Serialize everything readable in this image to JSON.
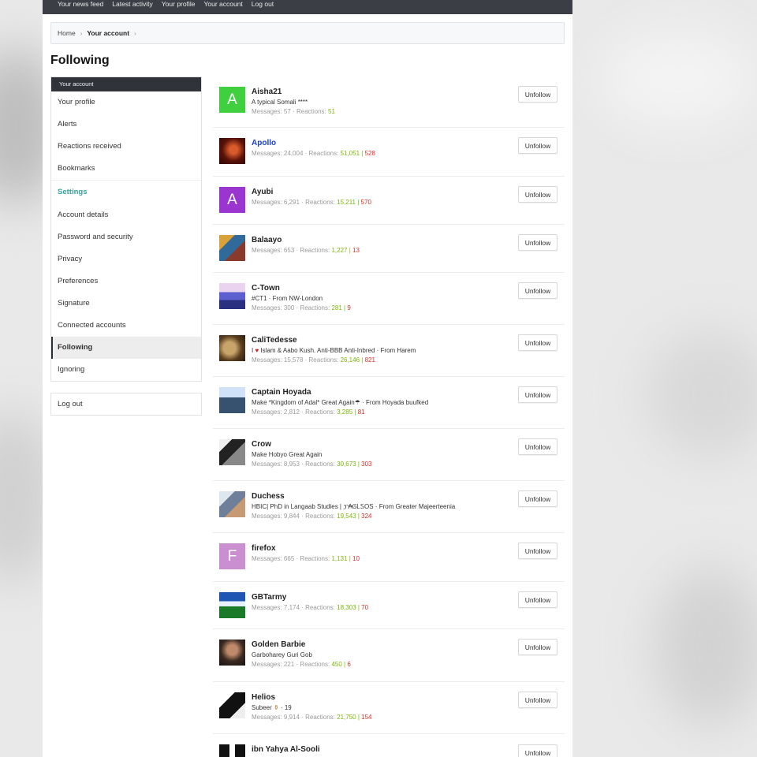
{
  "topnav": [
    "Your news feed",
    "Latest activity",
    "Your profile",
    "Your account",
    "Log out"
  ],
  "breadcrumb": {
    "home": "Home",
    "current": "Your account",
    "sep": "›"
  },
  "page_title": "Following",
  "sidebar": {
    "header": "Your account",
    "group1": [
      "Your profile",
      "Alerts",
      "Reactions received",
      "Bookmarks"
    ],
    "settings_heading": "Settings",
    "group2": [
      "Account details",
      "Password and security",
      "Privacy",
      "Preferences",
      "Signature",
      "Connected accounts",
      "Following",
      "Ignoring"
    ],
    "active": "Following",
    "logout": "Log out"
  },
  "unfollow_label": "Unfollow",
  "stats_labels": {
    "messages": "Messages:",
    "reactions": "Reactions:",
    "dot": "·",
    "bar": "|"
  },
  "colors": {
    "positive": "#7bb60c",
    "negative": "#d9302a",
    "settings_heading": "#3a9ea0",
    "link": "#1b3fd3",
    "topbar": "#3b3f45"
  },
  "following": [
    {
      "name": "Aisha21",
      "title": "A typical Somali ****",
      "messages": "57",
      "reactions": "51",
      "neg": "",
      "avatar_letter": "A",
      "avatar_color": "#3fcf3f"
    },
    {
      "name": "Apollo",
      "title": "",
      "messages": "24,004",
      "reactions": "51,051",
      "neg": "528",
      "avatar_letter": "",
      "avatar_color": "#7a1d10"
    },
    {
      "name": "Ayubi",
      "title": "",
      "messages": "6,291",
      "reactions": "15,211",
      "neg": "570",
      "avatar_letter": "A",
      "avatar_color": "#9b35cf"
    },
    {
      "name": "Balaayo",
      "title": "",
      "messages": "653",
      "reactions": "1,227",
      "neg": "13",
      "avatar_letter": "",
      "avatar_color": "#2f6a9a"
    },
    {
      "name": "C-Town",
      "title": "#CT1 · From NW-London",
      "messages": "300",
      "reactions": "281",
      "neg": "9",
      "avatar_letter": "",
      "avatar_color": "#6b74c9"
    },
    {
      "name": "CaliTedesse",
      "title_pre": "I",
      "title_post": "Islam & Aabo Kush. Anti-BBB Anti-Inbred · From Harem",
      "title": "",
      "messages": "15,578",
      "reactions": "26,146",
      "neg": "821",
      "avatar_letter": "",
      "avatar_color": "#8a6a3a"
    },
    {
      "name": "Captain Hoyada",
      "title": "Make *Kingdom of Adal* Great Again☂ · From Hoyada buufked",
      "messages": "2,812",
      "reactions": "3,285",
      "neg": "81",
      "avatar_letter": "",
      "avatar_color": "#5a86b3"
    },
    {
      "name": "Crow",
      "title": "Make Hobyo Great Again",
      "messages": "8,953",
      "reactions": "30,673",
      "neg": "303",
      "avatar_letter": "",
      "avatar_color": "#555555"
    },
    {
      "name": "Duchess",
      "title": "HBIC| PhD in Langaab Studies | ፓ₳ᎶᏞᏚOS · From Greater Majeerteenia",
      "messages": "9,844",
      "reactions": "19,543",
      "neg": "324",
      "avatar_letter": "",
      "avatar_color": "#7a8aa3"
    },
    {
      "name": "firefox",
      "title": "",
      "messages": "665",
      "reactions": "1,131",
      "neg": "10",
      "avatar_letter": "F",
      "avatar_color": "#c98fce"
    },
    {
      "name": "GBTarmy",
      "title": "",
      "messages": "7,174",
      "reactions": "18,303",
      "neg": "70",
      "avatar_letter": "",
      "avatar_color": "#2c66b8"
    },
    {
      "name": "Golden Barbie",
      "title": "Garboharey Guri Gob",
      "messages": "221",
      "reactions": "450",
      "neg": "6",
      "avatar_letter": "",
      "avatar_color": "#3a2a22"
    },
    {
      "name": "Helios",
      "title_pre": "Subeer",
      "title_post": "· 19",
      "title": "",
      "messages": "9,914",
      "reactions": "21,750",
      "neg": "154",
      "avatar_letter": "",
      "avatar_color": "#222222"
    },
    {
      "name": "ibn Yahya Al-Sooli",
      "title": "",
      "messages": "",
      "reactions": "",
      "neg": "",
      "avatar_letter": "",
      "avatar_color": "#1a1a1a"
    }
  ]
}
